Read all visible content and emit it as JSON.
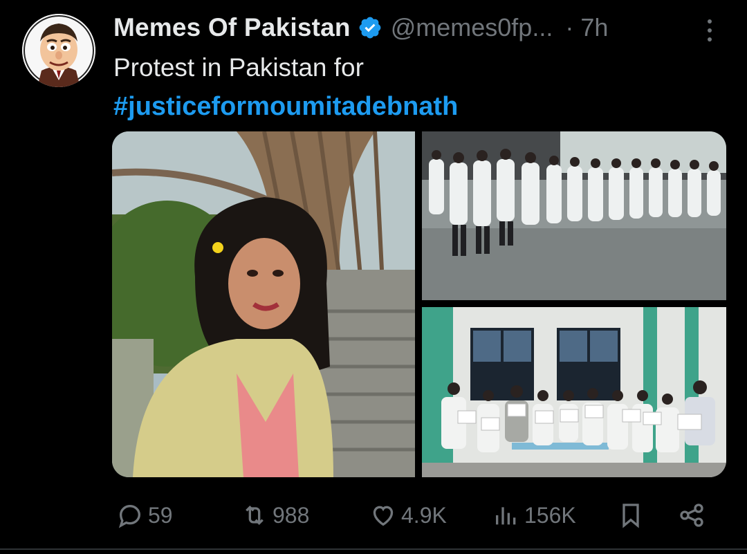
{
  "post": {
    "author_name": "Memes Of Pakistan",
    "handle": "@memes0fp...",
    "time": "· 7h",
    "text": "Protest in Pakistan for",
    "hashtag": "#justiceformoumitadebnath"
  },
  "actions": {
    "replies": "59",
    "reposts": "988",
    "likes": "4.9K",
    "views": "156K"
  },
  "icons": {
    "verified": "verified-badge-icon",
    "more": "more-vertical-icon",
    "reply": "reply-icon",
    "repost": "repost-icon",
    "like": "heart-icon",
    "views": "views-icon",
    "bookmark": "bookmark-icon",
    "share": "share-icon"
  },
  "colors": {
    "background": "#000000",
    "text": "#e7e9ea",
    "muted": "#71767b",
    "link": "#1d9bf0",
    "verified": "#1d9bf0"
  }
}
